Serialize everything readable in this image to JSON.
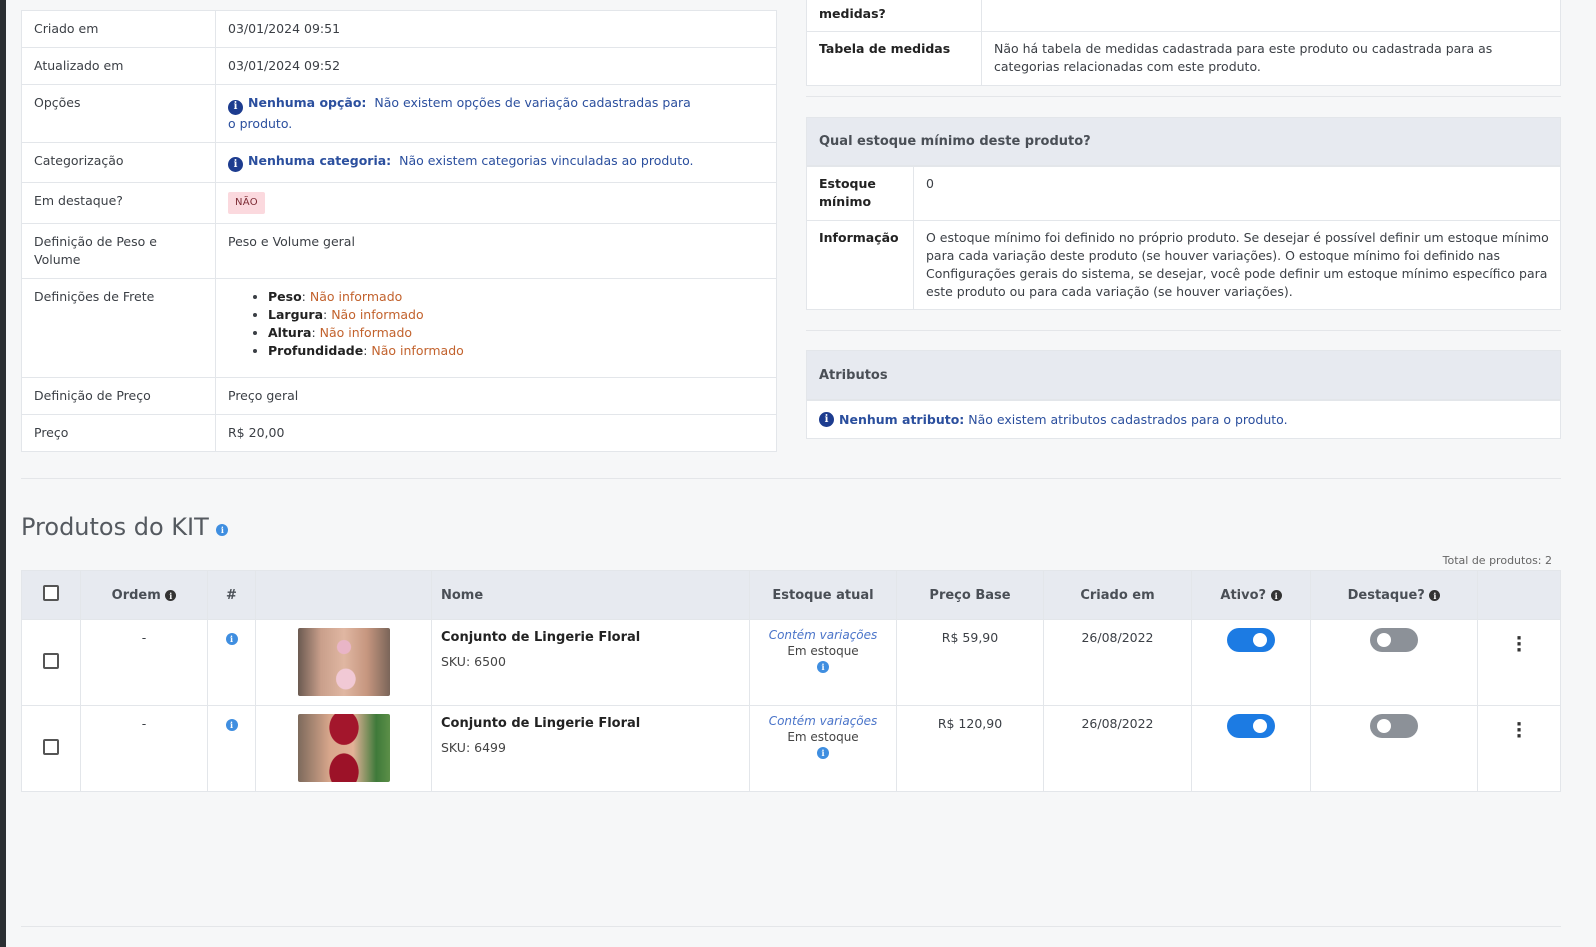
{
  "general_info": {
    "created_label": "Criado em",
    "created_value": "03/01/2024 09:51",
    "updated_label": "Atualizado em",
    "updated_value": "03/01/2024 09:52",
    "options_label": "Opções",
    "options_title": "Nenhuma opção:",
    "options_text": "Não existem opções de variação cadastradas para o produto.",
    "categorization_label": "Categorização",
    "categorization_title": "Nenhuma categoria:",
    "categorization_text": "Não existem categorias vinculadas ao produto.",
    "featured_label": "Em destaque?",
    "featured_value": "NÃO",
    "weight_label": "Definição de Peso e Volume",
    "weight_value": "Peso e Volume geral",
    "shipping_label": "Definições de Frete",
    "shipping_items": [
      {
        "name": "Peso",
        "value": "Não informado"
      },
      {
        "name": "Largura",
        "value": "Não informado"
      },
      {
        "name": "Altura",
        "value": "Não informado"
      },
      {
        "name": "Profundidade",
        "value": "Não informado"
      }
    ],
    "price_def_label": "Definição de Preço",
    "price_def_value": "Preço geral",
    "price_label": "Preço",
    "price_value": "R$ 20,00"
  },
  "measurements": {
    "question_tail": "medidas?",
    "table_label": "Tabela de medidas",
    "table_value": "Não há tabela de medidas cadastrada para este produto ou cadastrada para as categorias relacionadas com este produto."
  },
  "min_stock": {
    "header": "Qual estoque mínimo deste produto?",
    "min_label": "Estoque mínimo",
    "min_value": "0",
    "info_label": "Informação",
    "info_value": "O estoque mínimo foi definido no próprio produto. Se desejar é possível definir um estoque mínimo para cada variação deste produto (se houver variações). O estoque mínimo foi definido nas Configurações gerais do sistema, se desejar, você pode definir um estoque mínimo específico para este produto ou para cada variação (se houver variações)."
  },
  "attributes": {
    "header": "Atributos",
    "empty_title": "Nenhum atributo:",
    "empty_text": "Não existem atributos cadastrados para o produto."
  },
  "kit": {
    "title": "Produtos do KIT",
    "total": "Total de produtos: 2",
    "columns": {
      "order": "Ordem",
      "hash": "#",
      "name": "Nome",
      "stock": "Estoque atual",
      "price": "Preço Base",
      "created": "Criado em",
      "active": "Ativo?",
      "featured": "Destaque?"
    },
    "rows": [
      {
        "order": "-",
        "name": "Conjunto de Lingerie Floral",
        "sku": "SKU: 6500",
        "variation": "Contém variações",
        "stock": "Em estoque",
        "price": "R$ 59,90",
        "created": "26/08/2022",
        "active": true,
        "featured": false
      },
      {
        "order": "-",
        "name": "Conjunto de Lingerie Floral",
        "sku": "SKU: 6499",
        "variation": "Contém variações",
        "stock": "Em estoque",
        "price": "R$ 120,90",
        "created": "26/08/2022",
        "active": true,
        "featured": false
      }
    ]
  },
  "icons": {
    "info": "info-circle-icon",
    "more": "more-vertical-icon"
  },
  "colors": {
    "accent": "#1c7be3",
    "info_dark": "#1d3c8f",
    "warning_text": "#c2622d",
    "badge_bg": "#fbd9de"
  }
}
